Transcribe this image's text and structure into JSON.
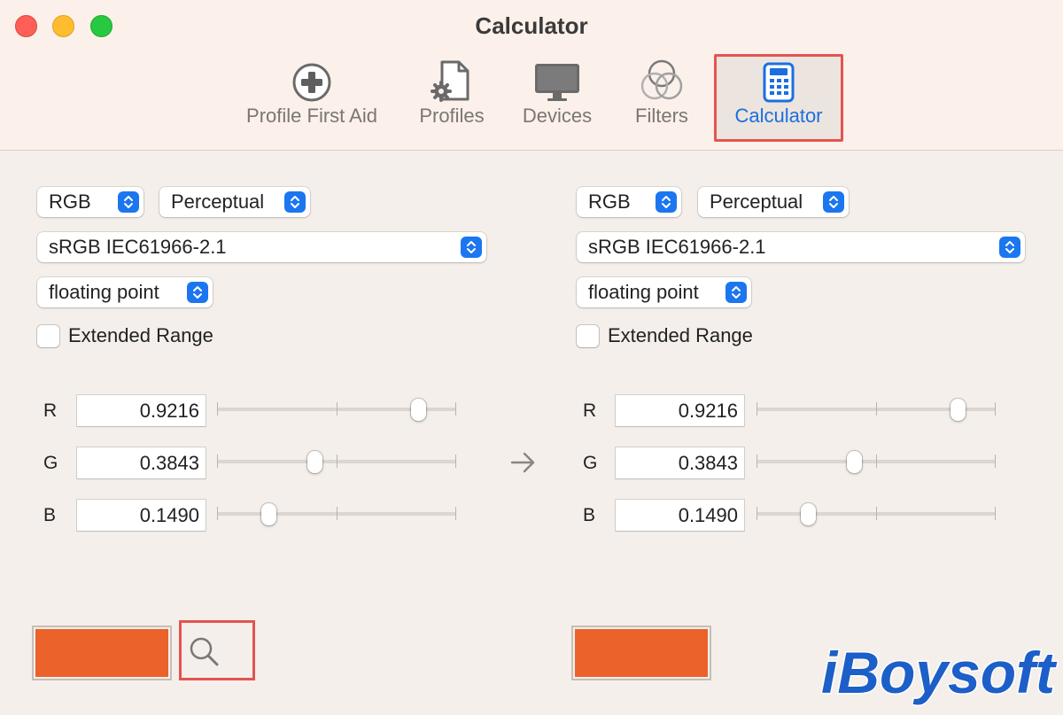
{
  "window": {
    "title": "Calculator"
  },
  "toolbar": {
    "items": [
      {
        "label": "Profile First Aid",
        "icon": "plus-circle-icon"
      },
      {
        "label": "Profiles",
        "icon": "document-gear-icon"
      },
      {
        "label": "Devices",
        "icon": "monitor-icon"
      },
      {
        "label": "Filters",
        "icon": "circles-icon"
      },
      {
        "label": "Calculator",
        "icon": "calculator-icon",
        "active": true
      }
    ]
  },
  "source": {
    "color_model": "RGB",
    "intent": "Perceptual",
    "profile": "sRGB IEC61966-2.1",
    "number_format": "floating point",
    "extended_range_label": "Extended Range",
    "extended_range_checked": false,
    "channels": [
      {
        "label": "R",
        "value": "0.9216",
        "level": 0.9216
      },
      {
        "label": "G",
        "value": "0.3843",
        "level": 0.3843
      },
      {
        "label": "B",
        "value": "0.1490",
        "level": 0.149
      }
    ],
    "swatch_color": "#eb622a"
  },
  "destination": {
    "color_model": "RGB",
    "intent": "Perceptual",
    "profile": "sRGB IEC61966-2.1",
    "number_format": "floating point",
    "extended_range_label": "Extended Range",
    "extended_range_checked": false,
    "channels": [
      {
        "label": "R",
        "value": "0.9216",
        "level": 0.9216
      },
      {
        "label": "G",
        "value": "0.3843",
        "level": 0.3843
      },
      {
        "label": "B",
        "value": "0.1490",
        "level": 0.149
      }
    ],
    "swatch_color": "#eb622a"
  },
  "colors": {
    "accent": "#1b76f0",
    "highlight": "#e35450",
    "watermark": "#1d5fc8"
  },
  "watermark": {
    "brand": "iBoysoft"
  }
}
